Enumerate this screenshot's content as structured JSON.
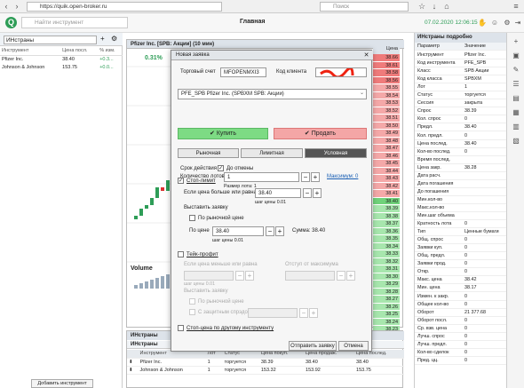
{
  "browser": {
    "url": "https://quik.open-broker.ru",
    "search_placeholder": "Поиск"
  },
  "app": {
    "title": "Главная",
    "search_placeholder": "Найти инструмент",
    "datetime": "07.02.2020 12:06:15"
  },
  "left": {
    "select_value": "ИНстраны",
    "columns": [
      "Инструмент",
      "Цена посл.",
      "% изм."
    ],
    "rows": [
      {
        "name": "Pfizer Inc.",
        "price": "38.40",
        "change": "+0.3..."
      },
      {
        "name": "Johnson & Johnson",
        "price": "153.75",
        "change": "+0.0..."
      }
    ],
    "add_button": "Добавить инструмент"
  },
  "chart": {
    "header": "Pfizer Inc. [SPB: Акции] (10 мин)",
    "change_pct": "0.31%",
    "volume_label": "Volume"
  },
  "chart_data": {
    "type": "candlestick",
    "title": "Pfizer Inc. [SPB: Акции] (10 мин)",
    "series": [
      {
        "name": "Pfizer Inc.",
        "values": [
          38.28,
          38.3,
          38.31,
          38.33,
          38.36,
          38.35,
          38.38,
          38.4
        ]
      }
    ]
  },
  "ladder": {
    "header": "Цена",
    "ask": [
      "38.66",
      "38.61",
      "38.58",
      "38.56",
      "38.55",
      "38.54",
      "38.53",
      "38.52",
      "38.51",
      "38.50",
      "38.49",
      "38.48",
      "38.47",
      "38.46",
      "38.45",
      "38.44",
      "38.43",
      "38.42",
      "38.41"
    ],
    "bid": [
      "38.40",
      "38.39",
      "38.38",
      "38.37",
      "38.36",
      "38.35",
      "38.34",
      "38.33",
      "38.32",
      "38.31",
      "38.30",
      "38.29",
      "38.28",
      "38.27",
      "38.26",
      "38.25",
      "38.24",
      "38.23",
      "38.22",
      "38.21",
      "37.99",
      "37.98",
      "37.97",
      "37.96",
      "37.95"
    ]
  },
  "orders": {
    "header": "ИНстраны",
    "tab": "ИНстраны",
    "columns": [
      "",
      "Инструмент",
      "Лот",
      "Статус",
      "Цена покуп.",
      "Цена продаж.",
      "Цена послед."
    ],
    "rows": [
      {
        "name": "Pfizer Inc.",
        "lot": "1",
        "status": "торгуется",
        "buy": "38.39",
        "sell": "38.40",
        "last": "38.40"
      },
      {
        "name": "Johnson & Johnson",
        "lot": "1",
        "status": "торгуется",
        "buy": "153.32",
        "sell": "153.92",
        "last": "153.75"
      }
    ]
  },
  "right": {
    "title": "ИНстраны подробно",
    "col1": "Параметр",
    "col2": "Значение",
    "rows": [
      [
        "Инструмент",
        "Pfizer Inc."
      ],
      [
        "Код инструмента",
        "PFE_SPB"
      ],
      [
        "Класс",
        "SPB Акции"
      ],
      [
        "Код класса",
        "SPBXM"
      ],
      [
        "Лот",
        "1"
      ],
      [
        "Статус",
        "торгуется"
      ],
      [
        "Сессия",
        "закрыта"
      ],
      [
        "Спрос",
        "38.39"
      ],
      [
        "Кол. спрос",
        "0"
      ],
      [
        "Предл.",
        "38.40"
      ],
      [
        "Кол. предл.",
        "0"
      ],
      [
        "Цена послед.",
        "38.40"
      ],
      [
        "Кол-во послед.",
        "0"
      ],
      [
        "Время послед.",
        ""
      ],
      [
        "Цена закр.",
        "38.28"
      ],
      [
        "Дата расч.",
        ""
      ],
      [
        "Дата погашения",
        ""
      ],
      [
        "До погашения",
        ""
      ],
      [
        "Мин.кол-во",
        ""
      ],
      [
        "Макс.кол-во",
        ""
      ],
      [
        "Мин.шаг объема",
        ""
      ],
      [
        "Кратность лота",
        "0"
      ],
      [
        "Тип",
        "Ценные бумаги"
      ],
      [
        "Общ. спрос",
        "0"
      ],
      [
        "Заявки куп.",
        "0"
      ],
      [
        "Общ. предл.",
        "0"
      ],
      [
        "Заявки прод.",
        "0"
      ],
      [
        "Откр.",
        "0"
      ],
      [
        "Макс. цена",
        "38.42"
      ],
      [
        "Мин. цена",
        "38.17"
      ],
      [
        "Измен. к закр.",
        "0"
      ],
      [
        "Общее кол-во",
        "0"
      ],
      [
        "Оборот",
        "21 377.68"
      ],
      [
        "Оборот посл.",
        "0"
      ],
      [
        "Ср. взв. цена",
        "0"
      ],
      [
        "Лучш. спрос",
        "0"
      ],
      [
        "Лучш. предл.",
        "0"
      ],
      [
        "Кол-во сделок",
        "0"
      ],
      [
        "Пред. цц.",
        "0"
      ]
    ]
  },
  "dialog": {
    "title": "Новая заявка",
    "account_label": "Торговый счет",
    "account_value": "MFOPENMXI3",
    "client_label": "Код клиента",
    "instrument_value": "PFE_SPB  Pfizer Inc.  (SPBXM  SPB: Акции)",
    "buy": "Купить",
    "sell": "Продать",
    "qty_label": "Количество лотов",
    "qty_value": "1",
    "max_link": "Максимум: 0",
    "lot_size": "Размер лота: 1",
    "tabs": [
      "Рыночная",
      "Лимитная",
      "Условная"
    ],
    "validity_label": "Срок действия",
    "until_cancel": "До отмены",
    "stop_limit": "Стоп-лимит",
    "if_price_label": "Если цена больше или равна",
    "if_price_value": "38.40",
    "price_step": "шаг цены 0.01",
    "place_order": "Выставить заявку",
    "market_price": "По рыночной цене",
    "by_price_label": "По цене",
    "by_price_value": "38.40",
    "sum_label": "Сумма: 38.40",
    "take_profit": "Тейк-профит",
    "if_price_less": "Если цена меньше или равна",
    "indent_from_max": "Отступ от максимума",
    "price_step2": "шаг цены 0.01",
    "place_order2": "Выставить заявку",
    "market_price2": "По рыночной цене",
    "protective_spread": "С защитным спрэдом",
    "stop_other": "Стоп-цена по другому инструменту",
    "send_button": "Отправить заявку",
    "cancel_button": "Отмена"
  }
}
